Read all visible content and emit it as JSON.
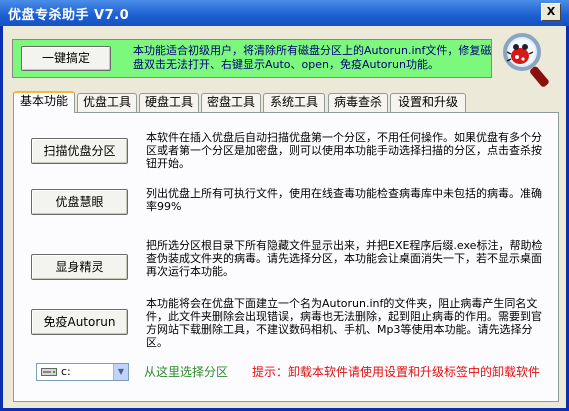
{
  "window": {
    "title": "优盘专杀助手  V7.0",
    "close_label": "X"
  },
  "top_panel": {
    "quick_button": "一键搞定",
    "description": "本功能适合初级用户，将清除所有磁盘分区上的Autorun.inf文件，修复磁盘双击无法打开、右键显示Auto、open，免疫Autorun功能。"
  },
  "logo": {
    "icon": "magnifier-bug-icon"
  },
  "tabs": [
    {
      "label": "基本功能",
      "active": true
    },
    {
      "label": "优盘工具"
    },
    {
      "label": "硬盘工具"
    },
    {
      "label": "密盘工具"
    },
    {
      "label": "系统工具"
    },
    {
      "label": "病毒查杀"
    },
    {
      "label": "设置和升级"
    }
  ],
  "functions": [
    {
      "button": "扫描优盘分区",
      "description": "本软件在插入优盘后自动扫描优盘第一个分区，不用任何操作。如果优盘有多个分区或者第一个分区是加密盘，则可以使用本功能手动选择扫描的分区，点击查杀按钮开始。"
    },
    {
      "button": "优盘慧眼",
      "description": "列出优盘上所有可执行文件，使用在线查毒功能检查病毒库中未包括的病毒。准确率99%"
    },
    {
      "button": "显身精灵",
      "description": "把所选分区根目录下所有隐藏文件显示出来，并把EXE程序后缀.exe标注，帮助检查伪装成文件夹的病毒。请先选择分区，本功能会让桌面消失一下，若不显示桌面再次运行本功能。"
    },
    {
      "button": "免疫Autorun",
      "description": "本功能将会在优盘下面建立一个名为Autorun.inf的文件夹，阻止病毒产生同名文件，此文件夹删除会出现错误，病毒也无法删除，起到阻止病毒的作用。需要到官方网站下载删除工具，不建议数码相机、手机、Mp3等使用本功能。请先选择分区。"
    }
  ],
  "partition_select": {
    "value": "c:",
    "icon": "drive-icon"
  },
  "hints": {
    "select_partition": "从这里选择分区",
    "uninstall": "提示：卸载本软件请使用设置和升级标签中的卸载软件"
  }
}
